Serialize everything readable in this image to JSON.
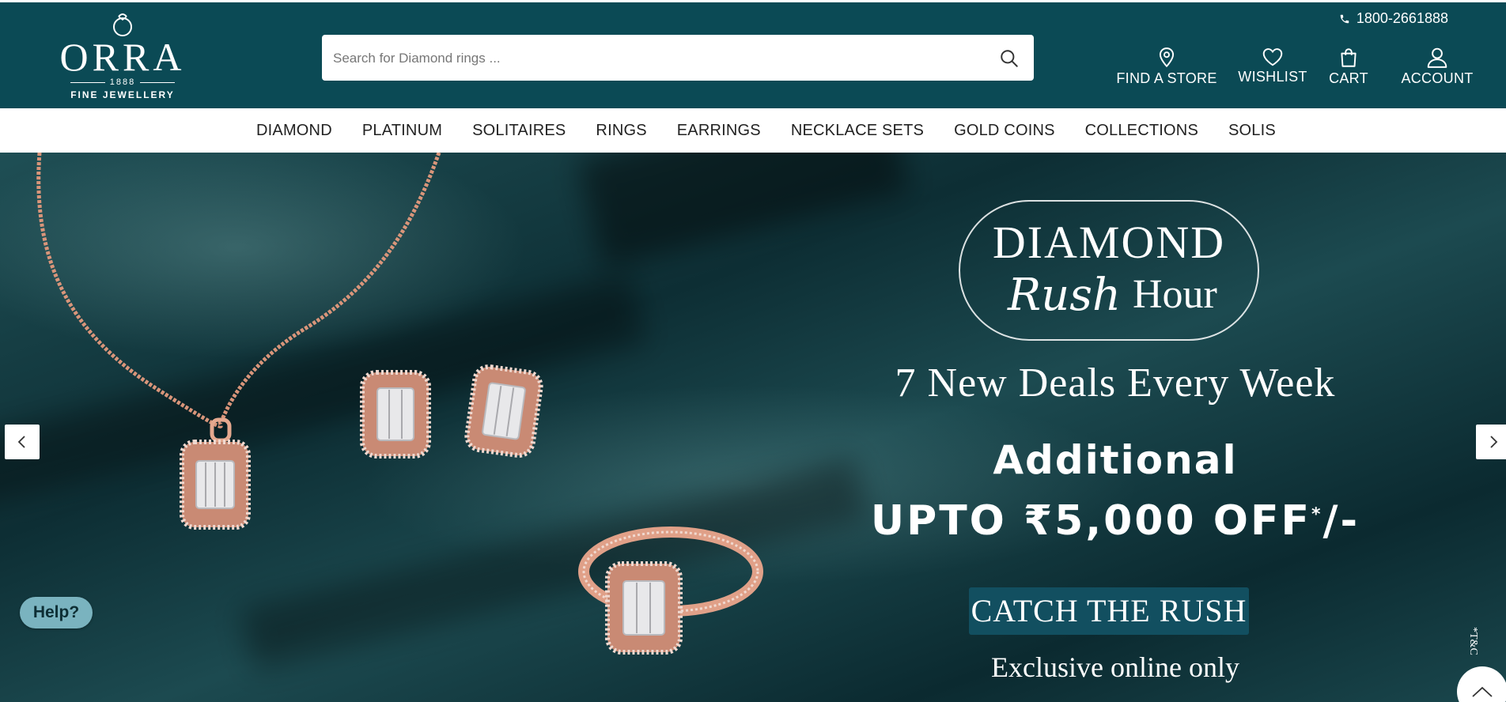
{
  "brand": {
    "name": "ORRA",
    "year": "1888",
    "tagline": "FINE JEWELLERY"
  },
  "header": {
    "phone": "1800-2661888",
    "search_placeholder": "Search for Diamond rings ...",
    "actions": {
      "find_store": "FIND A STORE",
      "wishlist": "WISHLIST",
      "cart": "CART",
      "account": "ACCOUNT"
    }
  },
  "nav": {
    "items": [
      "DIAMOND",
      "PLATINUM",
      "SOLITAIRES",
      "RINGS",
      "EARRINGS",
      "NECKLACE SETS",
      "GOLD COINS",
      "COLLECTIONS",
      "SOLIS"
    ]
  },
  "hero": {
    "badge_line1": "DIAMOND",
    "badge_script": "Rush",
    "badge_line2": "Hour",
    "deals": "7 New Deals Every Week",
    "additional": "Additional",
    "offer": "UPTO ₹5,000 OFF",
    "offer_mark": "*",
    "offer_suffix": "/-",
    "cta": "CATCH THE RUSH",
    "exclusive": "Exclusive online only",
    "terms": "*T&C"
  },
  "widgets": {
    "help": "Help?"
  },
  "colors": {
    "header_bg": "#0b4a55",
    "cta_bg": "#124f60",
    "help_bg": "#7ab3bf",
    "rose_gold": "#d9957a"
  },
  "icons": [
    "phone-icon",
    "search-icon",
    "location-pin-icon",
    "heart-icon",
    "shopping-bag-icon",
    "user-icon",
    "chevron-left-icon",
    "chevron-right-icon",
    "chevron-up-icon"
  ]
}
